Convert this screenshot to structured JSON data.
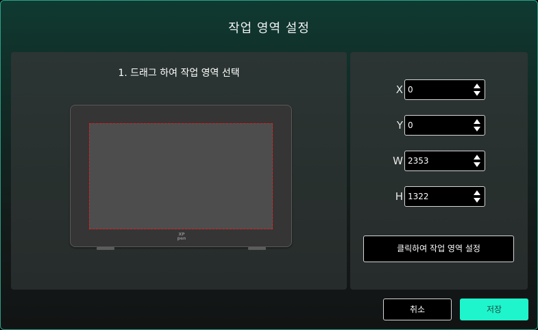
{
  "dialog": {
    "title": "작업 영역 설정"
  },
  "preview": {
    "instruction": "1. 드래그 하여 작업 영역 선택",
    "logo_top": "XP",
    "logo_bottom": "pen"
  },
  "fields": [
    {
      "label": "X",
      "value": "0"
    },
    {
      "label": "Y",
      "value": "0"
    },
    {
      "label": "W",
      "value": "2353"
    },
    {
      "label": "H",
      "value": "1322"
    }
  ],
  "buttons": {
    "set_area": "클릭하여 작업 영역 설정",
    "cancel": "취소",
    "save": "저장"
  },
  "colors": {
    "accent": "#1ef5cc",
    "selection_border": "#e02020"
  }
}
